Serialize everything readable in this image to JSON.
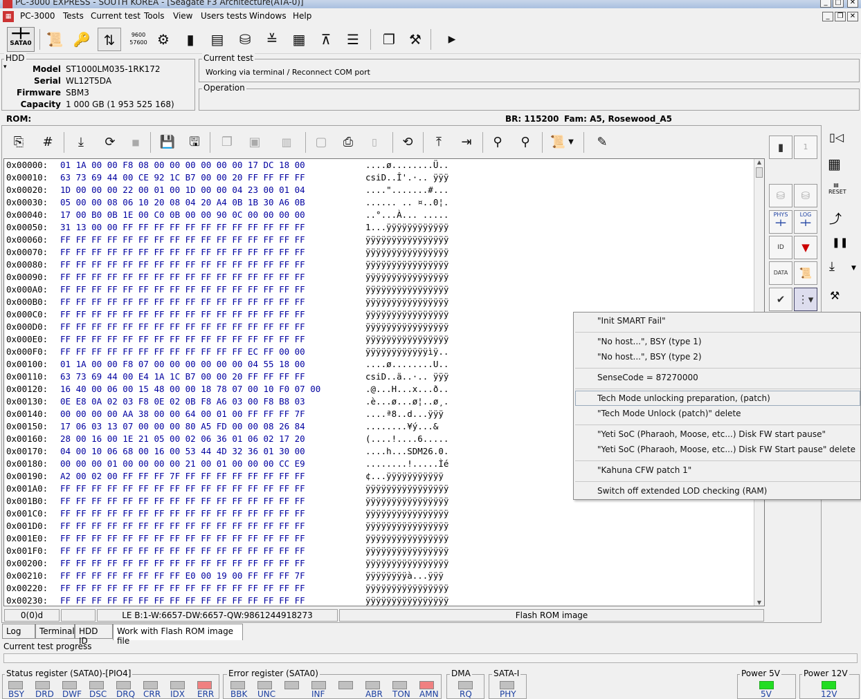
{
  "window": {
    "title": "PC-3000 EXPRESS - SOUTH KOREA - [Seagate F3 Architecture(ATA-0)]"
  },
  "menu": [
    "PC-3000",
    "Tests",
    "Current test",
    "Tools",
    "View",
    "Users tests",
    "Windows",
    "Help"
  ],
  "toolbar": {
    "sata_label": "SATA0",
    "rate_label_top": "9600",
    "rate_label_bottom": "57600"
  },
  "hdd": {
    "group_label": "HDD",
    "model_label": "Model",
    "model": "ST1000LM035-1RK172",
    "serial_label": "Serial",
    "serial": "WL12T5DA",
    "firmware_label": "Firmware",
    "firmware": "SBM3",
    "capacity_label": "Capacity",
    "capacity": "1 000 GB (1 953 525 168)"
  },
  "current_test": {
    "label": "Current test",
    "value": "Working via terminal / Reconnect COM port"
  },
  "operation": {
    "label": "Operation"
  },
  "rom": {
    "label": "ROM:",
    "br": "BR: 115200",
    "fam": "Fam: A5, Rosewood_A5"
  },
  "hex_rows": [
    {
      "addr": "0x00000:",
      "hex": "01 1A 00 00 F8 08 00 00 00 00 00 00 17 DC 18 00",
      "text": "....ø........Ü.."
    },
    {
      "addr": "0x00010:",
      "hex": "63 73 69 44 00 CE 92 1C B7 00 00 20 FF FF FF FF",
      "text": "csiD..Î'.·.. ÿÿÿ"
    },
    {
      "addr": "0x00020:",
      "hex": "1D 00 00 00 22 00 01 00 1D 00 00 04 23 00 01 04",
      "text": "....\".......#..."
    },
    {
      "addr": "0x00030:",
      "hex": "05 00 00 08 06 10 20 08 04 20 A4 0B 1B 30 A6 0B",
      "text": "...... .. ¤..0¦."
    },
    {
      "addr": "0x00040:",
      "hex": "17 00 B0 0B 1E 00 C0 0B 00 00 90 0C 00 00 00 00",
      "text": "..°...À... ....."
    },
    {
      "addr": "0x00050:",
      "hex": "31 13 00 00 FF FF FF FF FF FF FF FF FF FF FF FF",
      "text": "1...ÿÿÿÿÿÿÿÿÿÿÿÿ"
    },
    {
      "addr": "0x00060:",
      "hex": "FF FF FF FF FF FF FF FF FF FF FF FF FF FF FF FF",
      "text": "ÿÿÿÿÿÿÿÿÿÿÿÿÿÿÿÿ"
    },
    {
      "addr": "0x00070:",
      "hex": "FF FF FF FF FF FF FF FF FF FF FF FF FF FF FF FF",
      "text": "ÿÿÿÿÿÿÿÿÿÿÿÿÿÿÿÿ"
    },
    {
      "addr": "0x00080:",
      "hex": "FF FF FF FF FF FF FF FF FF FF FF FF FF FF FF FF",
      "text": "ÿÿÿÿÿÿÿÿÿÿÿÿÿÿÿÿ"
    },
    {
      "addr": "0x00090:",
      "hex": "FF FF FF FF FF FF FF FF FF FF FF FF FF FF FF FF",
      "text": "ÿÿÿÿÿÿÿÿÿÿÿÿÿÿÿÿ"
    },
    {
      "addr": "0x000A0:",
      "hex": "FF FF FF FF FF FF FF FF FF FF FF FF FF FF FF FF",
      "text": "ÿÿÿÿÿÿÿÿÿÿÿÿÿÿÿÿ"
    },
    {
      "addr": "0x000B0:",
      "hex": "FF FF FF FF FF FF FF FF FF FF FF FF FF FF FF FF",
      "text": "ÿÿÿÿÿÿÿÿÿÿÿÿÿÿÿÿ"
    },
    {
      "addr": "0x000C0:",
      "hex": "FF FF FF FF FF FF FF FF FF FF FF FF FF FF FF FF",
      "text": "ÿÿÿÿÿÿÿÿÿÿÿÿÿÿÿÿ"
    },
    {
      "addr": "0x000D0:",
      "hex": "FF FF FF FF FF FF FF FF FF FF FF FF FF FF FF FF",
      "text": "ÿÿÿÿÿÿÿÿÿÿÿÿÿÿÿÿ"
    },
    {
      "addr": "0x000E0:",
      "hex": "FF FF FF FF FF FF FF FF FF FF FF FF FF FF FF FF",
      "text": "ÿÿÿÿÿÿÿÿÿÿÿÿÿÿÿÿ"
    },
    {
      "addr": "0x000F0:",
      "hex": "FF FF FF FF FF FF FF FF FF FF FF FF EC FF 00 00",
      "text": "ÿÿÿÿÿÿÿÿÿÿÿÿìÿ.."
    },
    {
      "addr": "0x00100:",
      "hex": "01 1A 00 00 F8 07 00 00 00 00 00 00 04 55 18 00",
      "text": "....ø........U.."
    },
    {
      "addr": "0x00110:",
      "hex": "63 73 69 44 00 E4 1A 1C B7 00 00 20 FF FF FF FF",
      "text": "csiD..ä..·.. ÿÿÿ"
    },
    {
      "addr": "0x00120:",
      "hex": "16 40 00 06 00 15 48 00 00 18 78 07 00 10 F0 07 00",
      "text": ".@...H...x...ð.."
    },
    {
      "addr": "0x00130:",
      "hex": "0E E8 0A 02 03 F8 0E 02 0B F8 A6 03 00 F8 B8 03",
      "text": ".è...ø...ø¦..ø¸."
    },
    {
      "addr": "0x00140:",
      "hex": "00 00 00 00 AA 38 00 00 64 00 01 00 FF FF FF 7F",
      "text": "....ª8..d...ÿÿÿ"
    },
    {
      "addr": "0x00150:",
      "hex": "17 06 03 13 07 00 00 00 80 A5 FD 00 00 08 26 84",
      "text": "........¥ý...&"
    },
    {
      "addr": "0x00160:",
      "hex": "28 00 16 00 1E 21 05 00 02 06 36 01 06 02 17 20",
      "text": "(....!....6....."
    },
    {
      "addr": "0x00170:",
      "hex": "04 00 10 06 68 00 16 00 53 44 4D 32 36 01 30 00",
      "text": "....h...SDM26.0."
    },
    {
      "addr": "0x00180:",
      "hex": "00 00 00 01 00 00 00 00 21 00 01 00 00 00 CC E9",
      "text": "........!.....Ìé"
    },
    {
      "addr": "0x00190:",
      "hex": "A2 00 02 00 FF FF FF 7F FF FF FF FF FF FF FF FF",
      "text": "¢...ÿÿÿÿÿÿÿÿÿÿÿ"
    },
    {
      "addr": "0x001A0:",
      "hex": "FF FF FF FF FF FF FF FF FF FF FF FF FF FF FF FF",
      "text": "ÿÿÿÿÿÿÿÿÿÿÿÿÿÿÿÿ"
    },
    {
      "addr": "0x001B0:",
      "hex": "FF FF FF FF FF FF FF FF FF FF FF FF FF FF FF FF",
      "text": "ÿÿÿÿÿÿÿÿÿÿÿÿÿÿÿÿ"
    },
    {
      "addr": "0x001C0:",
      "hex": "FF FF FF FF FF FF FF FF FF FF FF FF FF FF FF FF",
      "text": "ÿÿÿÿÿÿÿÿÿÿÿÿÿÿÿÿ"
    },
    {
      "addr": "0x001D0:",
      "hex": "FF FF FF FF FF FF FF FF FF FF FF FF FF FF FF FF",
      "text": "ÿÿÿÿÿÿÿÿÿÿÿÿÿÿÿÿ"
    },
    {
      "addr": "0x001E0:",
      "hex": "FF FF FF FF FF FF FF FF FF FF FF FF FF FF FF FF",
      "text": "ÿÿÿÿÿÿÿÿÿÿÿÿÿÿÿÿ"
    },
    {
      "addr": "0x001F0:",
      "hex": "FF FF FF FF FF FF FF FF FF FF FF FF FF FF FF FF",
      "text": "ÿÿÿÿÿÿÿÿÿÿÿÿÿÿÿÿ"
    },
    {
      "addr": "0x00200:",
      "hex": "FF FF FF FF FF FF FF FF FF FF FF FF FF FF FF FF",
      "text": "ÿÿÿÿÿÿÿÿÿÿÿÿÿÿÿÿ"
    },
    {
      "addr": "0x00210:",
      "hex": "FF FF FF FF FF FF FF FF E0 00 19 00 FF FF FF 7F",
      "text": "ÿÿÿÿÿÿÿÿà...ÿÿÿ"
    },
    {
      "addr": "0x00220:",
      "hex": "FF FF FF FF FF FF FF FF FF FF FF FF FF FF FF FF",
      "text": "ÿÿÿÿÿÿÿÿÿÿÿÿÿÿÿÿ"
    },
    {
      "addr": "0x00230:",
      "hex": "FF FF FF FF FF FF FF FF FF FF FF FF FF FF FF FF",
      "text": "ÿÿÿÿÿÿÿÿÿÿÿÿÿÿÿÿ"
    }
  ],
  "right_panel": {
    "counter": "1",
    "phys": "PHYS",
    "log": "LOG",
    "reset": "RESET",
    "id": "ID",
    "data": "DATA"
  },
  "popup_menu": [
    "\"Init SMART Fail\"",
    "\"No host...\", BSY (type 1)",
    "\"No host...\", BSY (type 2)",
    "SenseCode = 87270000",
    "Tech Mode unlocking preparation, (patch)",
    "\"Tech Mode Unlock (patch)\" delete",
    "\"Yeti SoC (Pharaoh, Moose, etc...) Disk FW start pause\"",
    "\"Yeti SoC (Pharaoh, Moose, etc...) Disk FW Start pause\" delete",
    "\"Kahuna CFW patch 1\"",
    "Switch off extended LOD checking (RAM)"
  ],
  "statusbar": {
    "pos": "0(0)d",
    "le": "LE B:1-W:6657-DW:6657-QW:9861244918273",
    "image": "Flash ROM image"
  },
  "tabs": [
    "Log",
    "Terminal",
    "HDD ID",
    "Work with Flash ROM image file"
  ],
  "progress": {
    "label": "Current test progress",
    "value": 0
  },
  "status_reg": {
    "label": "Status register (SATA0)-[PIO4]",
    "leds": [
      "BSY",
      "DRD",
      "DWF",
      "DSC",
      "DRQ",
      "CRR",
      "IDX",
      "ERR"
    ]
  },
  "error_reg": {
    "label": "Error register (SATA0)",
    "leds": [
      "BBK",
      "UNC",
      "",
      "INF",
      "",
      "ABR",
      "TON",
      "AMN"
    ]
  },
  "dma": {
    "label": "DMA",
    "led": "RQ"
  },
  "satai": {
    "label": "SATA-I",
    "led": "PHY"
  },
  "power5": {
    "label": "Power 5V",
    "led": "5V"
  },
  "power12": {
    "label": "Power 12V",
    "led": "12V"
  },
  "colors": {
    "led_on_red": "#f08080",
    "led_on_green": "#22dd22",
    "led_off": "#c0c0c0",
    "hex_blue": "#0000a0"
  }
}
